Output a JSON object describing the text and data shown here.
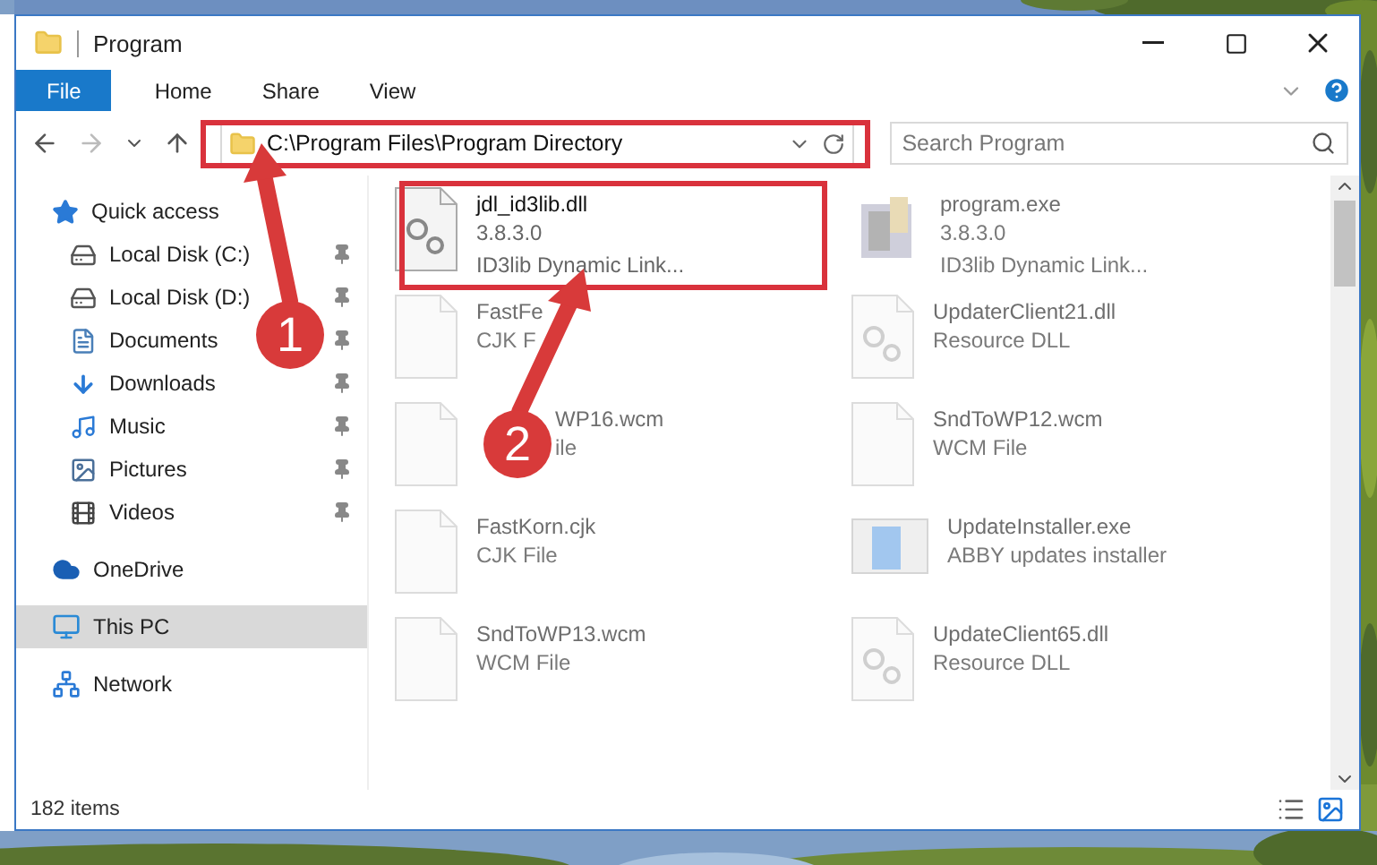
{
  "window": {
    "title": "Program"
  },
  "ribbon_tabs": [
    {
      "label": "File",
      "kind": "file"
    },
    {
      "label": "Home",
      "kind": "tab"
    },
    {
      "label": "Share",
      "kind": "tab"
    },
    {
      "label": "View",
      "kind": "tab"
    }
  ],
  "address_bar": {
    "path": "C:\\Program Files\\Program Directory"
  },
  "search": {
    "placeholder": "Search Program"
  },
  "sidebar": {
    "items": [
      {
        "label": "Quick access",
        "kind": "star",
        "selected": false,
        "children": [
          {
            "label": "Local Disk (C:)",
            "kind": "disk",
            "pinned": true,
            "selected": false
          },
          {
            "label": "Local Disk (D:)",
            "kind": "disk",
            "pinned": true,
            "selected": false
          },
          {
            "label": "Documents",
            "kind": "document",
            "pinned": true,
            "selected": false
          },
          {
            "label": "Downloads",
            "kind": "download",
            "pinned": true,
            "selected": false
          },
          {
            "label": "Music",
            "kind": "music",
            "pinned": true,
            "selected": false
          },
          {
            "label": "Pictures",
            "kind": "pictures",
            "pinned": true,
            "selected": false
          },
          {
            "label": "Videos",
            "kind": "videos",
            "pinned": true,
            "selected": false
          }
        ]
      },
      {
        "label": "OneDrive",
        "kind": "cloud",
        "selected": false
      },
      {
        "label": "This PC",
        "kind": "pc",
        "selected": true
      },
      {
        "label": "Network",
        "kind": "network",
        "selected": false
      }
    ]
  },
  "files": [
    {
      "name": "jdl_id3lib.dll",
      "details": [
        "3.8.3.0",
        "ID3lib Dynamic Link..."
      ],
      "kind": "dll",
      "faded": false
    },
    {
      "name": "program.exe",
      "details": [
        "3.8.3.0",
        "ID3lib Dynamic Link..."
      ],
      "kind": "exe",
      "faded": true
    },
    {
      "name": "FastFe",
      "details": [
        "CJK F"
      ],
      "kind": "blank",
      "faded": true
    },
    {
      "name": "UpdaterClient21.dll",
      "details": [
        "Resource DLL"
      ],
      "kind": "dll",
      "faded": true
    },
    {
      "name": "WP16.wcm",
      "details": [
        "ile"
      ],
      "kind": "blank",
      "faded": true,
      "covered_start": true
    },
    {
      "name": "SndToWP12.wcm",
      "details": [
        "WCM File"
      ],
      "kind": "blank",
      "faded": true
    },
    {
      "name": "FastKorn.cjk",
      "details": [
        "CJK File"
      ],
      "kind": "blank",
      "faded": true
    },
    {
      "name": "UpdateInstaller.exe",
      "details": [
        "ABBY updates installer"
      ],
      "kind": "installer",
      "faded": true
    },
    {
      "name": "SndToWP13.wcm",
      "details": [
        "WCM File"
      ],
      "kind": "blank",
      "faded": true
    },
    {
      "name": "UpdateClient65.dll",
      "details": [
        "Resource DLL"
      ],
      "kind": "dll",
      "faded": true
    }
  ],
  "status_bar": {
    "count": "182 items"
  },
  "annotations": [
    {
      "number": "1"
    },
    {
      "number": "2"
    }
  ]
}
